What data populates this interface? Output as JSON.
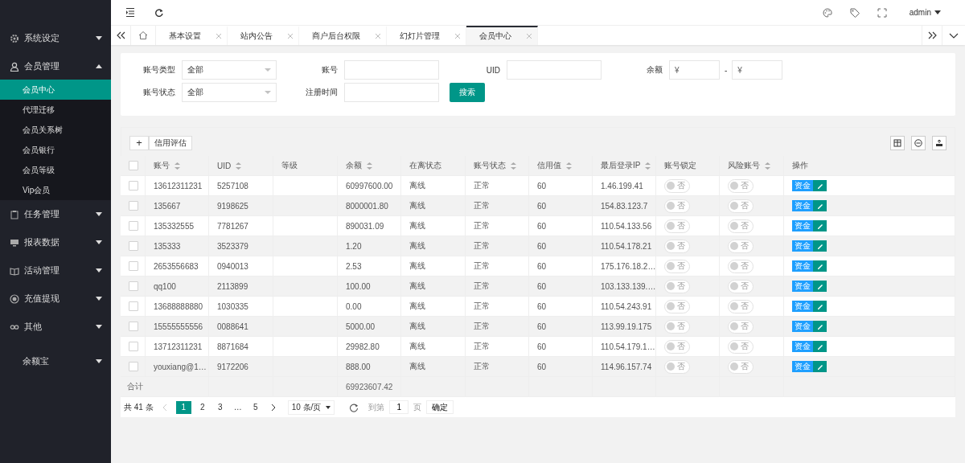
{
  "sidebar": {
    "menus": [
      {
        "label": "系统设定",
        "expanded": false
      },
      {
        "label": "会员管理",
        "expanded": true,
        "children": [
          {
            "label": "会员中心",
            "selected": true
          },
          {
            "label": "代理迁移",
            "selected": false
          },
          {
            "label": "会员关系树",
            "selected": false
          },
          {
            "label": "会员银行",
            "selected": false
          },
          {
            "label": "会员等级",
            "selected": false
          },
          {
            "label": "Vip会员",
            "selected": false
          }
        ]
      },
      {
        "label": "任务管理",
        "expanded": false
      },
      {
        "label": "报表数据",
        "expanded": false
      },
      {
        "label": "活动管理",
        "expanded": false
      },
      {
        "label": "充值提现",
        "expanded": false
      },
      {
        "label": "其他",
        "expanded": false
      },
      {
        "label": "余额宝",
        "expanded": false
      }
    ]
  },
  "topbar": {
    "user": "admin"
  },
  "tabs": [
    {
      "label": "基本设置",
      "selected": false
    },
    {
      "label": "站内公告",
      "selected": false
    },
    {
      "label": "商户后台权限",
      "selected": false
    },
    {
      "label": "幻灯片管理",
      "selected": false
    },
    {
      "label": "会员中心",
      "selected": true
    }
  ],
  "filters": [
    [
      {
        "kind": "select",
        "label": "账号类型",
        "value": "全部"
      },
      {
        "kind": "input",
        "label": "账号"
      },
      {
        "kind": "input",
        "label": "UID"
      },
      {
        "kind": "range",
        "label": "余额",
        "placeholder": "¥",
        "separator": "-",
        "placeholder_to": "¥"
      }
    ],
    [
      {
        "kind": "select",
        "label": "账号状态",
        "value": "全部"
      },
      {
        "kind": "input",
        "label": "注册时间"
      },
      {
        "kind": "button",
        "label": "搜索"
      }
    ]
  ],
  "table": {
    "toolbar": {
      "add": "+",
      "button": "信用评估"
    },
    "select_all": false,
    "columns": [
      {
        "label": "账号",
        "sortable": true
      },
      {
        "label": "UID",
        "sortable": true
      },
      {
        "label": "等级",
        "sortable": false
      },
      {
        "label": "余额",
        "sortable": true
      },
      {
        "label": "在离状态",
        "sortable": false
      },
      {
        "label": "账号状态",
        "sortable": true
      },
      {
        "label": "信用值",
        "sortable": true
      },
      {
        "label": "最后登录IP",
        "sortable": true
      },
      {
        "label": "账号锁定",
        "sortable": false
      },
      {
        "label": "风险账号",
        "sortable": true
      },
      {
        "label": "操作",
        "sortable": false
      }
    ],
    "rows": [
      {
        "checked": false,
        "account": "13612311231",
        "uid": "5257108",
        "balance": "60997600.00",
        "online": "离线",
        "status": "正常",
        "credit": "60",
        "ip": "1.46.199.41",
        "locked": false,
        "lock_text": "否",
        "risk": false,
        "risk_text": "否",
        "fund": "资金"
      },
      {
        "checked": false,
        "account": "135667",
        "uid": "9198625",
        "balance": "8000001.80",
        "online": "离线",
        "status": "正常",
        "credit": "60",
        "ip": "154.83.123.7",
        "locked": false,
        "lock_text": "否",
        "risk": false,
        "risk_text": "否",
        "fund": "资金"
      },
      {
        "checked": false,
        "account": "135332555",
        "uid": "7781267",
        "balance": "890031.09",
        "online": "离线",
        "status": "正常",
        "credit": "60",
        "ip": "110.54.133.56",
        "locked": false,
        "lock_text": "否",
        "risk": false,
        "risk_text": "否",
        "fund": "资金"
      },
      {
        "checked": false,
        "account": "135333",
        "uid": "3523379",
        "balance": "1.20",
        "online": "离线",
        "status": "正常",
        "credit": "60",
        "ip": "110.54.178.21",
        "locked": false,
        "lock_text": "否",
        "risk": false,
        "risk_text": "否",
        "fund": "资金"
      },
      {
        "checked": false,
        "account": "2653556683",
        "uid": "0940013",
        "balance": "2.53",
        "online": "离线",
        "status": "正常",
        "credit": "60",
        "ip": "175.176.18.2…",
        "locked": false,
        "lock_text": "否",
        "risk": false,
        "risk_text": "否",
        "fund": "资金"
      },
      {
        "checked": false,
        "account": "qq100",
        "uid": "2113899",
        "balance": "100.00",
        "online": "离线",
        "status": "正常",
        "credit": "60",
        "ip": "103.133.139.…",
        "locked": false,
        "lock_text": "否",
        "risk": false,
        "risk_text": "否",
        "fund": "资金"
      },
      {
        "checked": false,
        "account": "13688888880",
        "uid": "1030335",
        "balance": "0.00",
        "online": "离线",
        "status": "正常",
        "credit": "60",
        "ip": "110.54.243.91",
        "locked": false,
        "lock_text": "否",
        "risk": false,
        "risk_text": "否",
        "fund": "资金"
      },
      {
        "checked": false,
        "account": "15555555556",
        "uid": "0088641",
        "balance": "5000.00",
        "online": "离线",
        "status": "正常",
        "credit": "60",
        "ip": "113.99.19.175",
        "locked": false,
        "lock_text": "否",
        "risk": false,
        "risk_text": "否",
        "fund": "资金"
      },
      {
        "checked": false,
        "account": "13712311231",
        "uid": "8871684",
        "balance": "29982.80",
        "online": "离线",
        "status": "正常",
        "credit": "60",
        "ip": "110.54.179.1…",
        "locked": false,
        "lock_text": "否",
        "risk": false,
        "risk_text": "否",
        "fund": "资金"
      },
      {
        "checked": false,
        "account": "youxiang@1…",
        "uid": "9172206",
        "balance": "888.00",
        "online": "离线",
        "status": "正常",
        "credit": "60",
        "ip": "114.96.157.74",
        "locked": false,
        "lock_text": "否",
        "risk": false,
        "risk_text": "否",
        "fund": "资金"
      }
    ],
    "total": {
      "label": "合计",
      "balance": "69923607.42"
    }
  },
  "pager": {
    "count": "共 41 条",
    "prev_disabled": true,
    "pages": [
      {
        "label": "1",
        "selected": true
      },
      {
        "label": "2",
        "selected": false
      },
      {
        "label": "3",
        "selected": false
      },
      {
        "label": "…",
        "selected": false
      },
      {
        "label": "5",
        "selected": false
      }
    ],
    "page_size": "10 条/页",
    "goto_label": "到第",
    "goto_value": "1",
    "goto_unit": "页",
    "confirm": "确定"
  }
}
